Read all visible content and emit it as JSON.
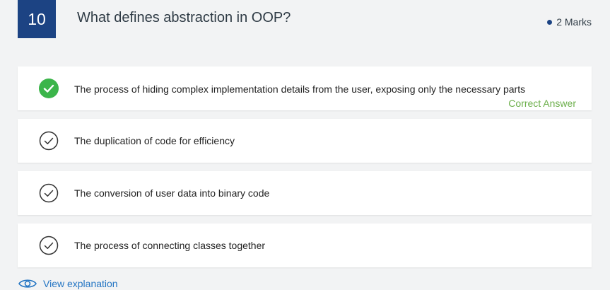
{
  "question": {
    "number": "10",
    "text": "What defines abstraction in OOP?",
    "marks": "2 Marks"
  },
  "options": [
    {
      "text": "The process of hiding complex implementation details from the user, exposing only the necessary parts",
      "correct": true
    },
    {
      "text": "The duplication of code for efficiency",
      "correct": false
    },
    {
      "text": "The conversion of user data into binary code",
      "correct": false
    },
    {
      "text": "The process of connecting classes together",
      "correct": false
    }
  ],
  "correct_answer_label": "Correct Answer",
  "explanation_link": "View explanation",
  "icons": {
    "correct": "check-circle-filled-icon",
    "option": "check-circle-outline-icon",
    "explanation": "eye-icon"
  },
  "colors": {
    "question_badge": "#1c4383",
    "correct": "#3bb54a",
    "correct_text": "#6caf4b",
    "link": "#2475c3"
  }
}
